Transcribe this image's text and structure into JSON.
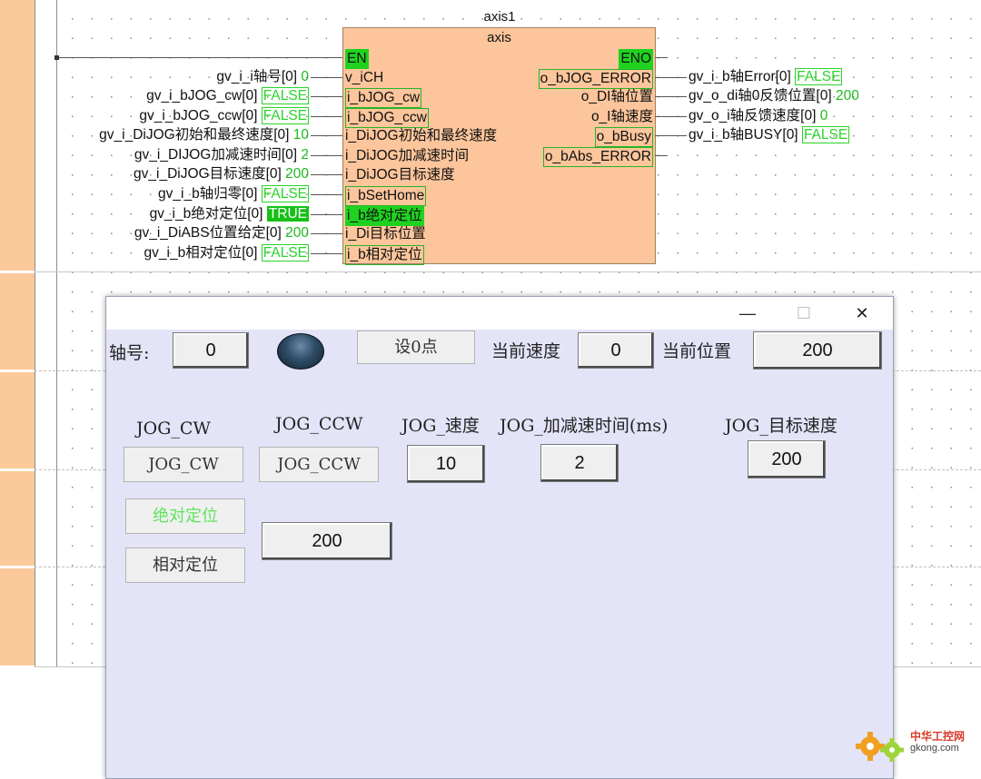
{
  "fb": {
    "instance": "axis1",
    "type": "axis",
    "inputs": [
      "EN",
      "v_iCH",
      "i_bJOG_cw",
      "i_bJOG_ccw",
      "i_DiJOG初始和最终速度",
      "i_DiJOG加减速时间",
      "i_DiJOG目标速度",
      "i_bSetHome",
      "i_b绝对定位",
      "i_Di目标位置",
      "i_b相对定位"
    ],
    "outputs": [
      "ENO",
      "o_bJOG_ERROR",
      "o_DI轴位置",
      "o_I轴速度",
      "o_bBusy",
      "o_bAbs_ERROR"
    ]
  },
  "left_vars": [
    {
      "name": "gv_i_i轴号[0]",
      "value": "0"
    },
    {
      "name": "gv_i_bJOG_cw[0]",
      "value": "FALSE"
    },
    {
      "name": "gv_i_bJOG_ccw[0]",
      "value": "FALSE"
    },
    {
      "name": "gv_i_DiJOG初始和最终速度[0]",
      "value": "10"
    },
    {
      "name": "gv_i_DIJOG加减速时间[0]",
      "value": "2"
    },
    {
      "name": "gv_i_DiJOG目标速度[0]",
      "value": "200"
    },
    {
      "name": "gv_i_b轴归零[0]",
      "value": "FALSE"
    },
    {
      "name": "gv_i_b绝对定位[0]",
      "value": "TRUE"
    },
    {
      "name": "gv_i_DiABS位置给定[0]",
      "value": "200"
    },
    {
      "name": "gv_i_b相对定位[0]",
      "value": "FALSE"
    }
  ],
  "right_vars": [
    {
      "name": "gv_i_b轴Error[0]",
      "value": "FALSE"
    },
    {
      "name": "gv_o_di轴0反馈位置[0]",
      "value": "200"
    },
    {
      "name": "gv_o_i轴反馈速度[0]",
      "value": "0"
    },
    {
      "name": "gv_i_b轴BUSY[0]",
      "value": "FALSE"
    }
  ],
  "dialog": {
    "controls": {
      "minimize": "—",
      "maximize": "☐",
      "close": "✕"
    },
    "axis_label": "轴号:",
    "axis_value": "0",
    "set_zero_button": "设0点",
    "current_speed_label": "当前速度",
    "current_speed_value": "0",
    "current_pos_label": "当前位置",
    "current_pos_value": "200",
    "jog_cw_label": "JOG_CW",
    "jog_cw_button": "JOG_CW",
    "jog_ccw_label": "JOG_CCW",
    "jog_ccw_button": "JOG_CCW",
    "jog_speed_label": "JOG_速度",
    "jog_speed_value": "10",
    "jog_accel_label": "JOG_加减速时间(ms)",
    "jog_accel_value": "2",
    "jog_target_label": "JOG_目标速度",
    "jog_target_value": "200",
    "abs_pos_button": "绝对定位",
    "abs_pos_value": "200",
    "rel_pos_button": "相对定位"
  },
  "watermark": {
    "line1": "中华工控网",
    "line2": "gkong.com"
  }
}
